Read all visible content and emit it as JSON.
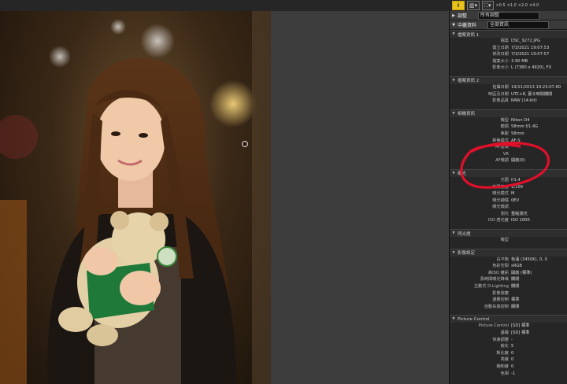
{
  "toolbar": {
    "info_label": "i",
    "zoom_levels": [
      "×0.5",
      "×1.0",
      "×2.0",
      "×4.0"
    ]
  },
  "panel": {
    "adjust": {
      "label": "調整",
      "select": "所有調整"
    },
    "metadata": {
      "label": "中繼資料",
      "select": "全部資訊"
    },
    "sections": [
      {
        "title": "檔案資訊 1",
        "rows": [
          [
            "檔案",
            "DSC_9272.JPG"
          ],
          [
            "建立日期",
            "7/3/2021 19:07:53"
          ],
          [
            "修改日期",
            "7/3/2021 19:07:57"
          ],
          [
            "檔案大小",
            "3.90 MB"
          ],
          [
            "影像大小",
            "L (7380 x 4920), FX"
          ]
        ]
      },
      {
        "title": "檔案資訊 2",
        "rows": [
          [
            "拍攝日期",
            "19/11/2013 19:23:07.60"
          ],
          [
            "時區及日期",
            "UTC+8, 夏令時間關閉"
          ],
          [
            "影像品質",
            "RAW (14-bit)"
          ]
        ]
      },
      {
        "title": "相機資訊",
        "rows": [
          [
            "機型",
            "Nikon D4"
          ],
          [
            "鏡頭",
            "58mm f/1.4G"
          ],
          [
            "焦距",
            "58mm"
          ],
          [
            "對焦模式",
            "AF-S"
          ],
          [
            "AF區域",
            ""
          ],
          [
            "VR",
            ""
          ],
          [
            "AF微調",
            "開啟(0)"
          ]
        ]
      },
      {
        "title": "曝光",
        "rows": [
          [
            "光圈",
            "f/1.4"
          ],
          [
            "快門速度",
            "1/100"
          ],
          [
            "曝光模式",
            "M"
          ],
          [
            "曝光補償",
            "0EV"
          ],
          [
            "曝光微調",
            ""
          ],
          [
            "測光",
            "重點測光"
          ],
          [
            "ISO 感光度",
            "ISO 1000"
          ]
        ]
      },
      {
        "title": "閃光燈",
        "rows": [
          [
            "機型",
            ""
          ]
        ]
      },
      {
        "title": "影像設定",
        "rows": [
          [
            "白平衡",
            "色溫 (3450K), 0, 0"
          ],
          [
            "色彩空間",
            "sRGB"
          ],
          [
            "高ISO 雜訊",
            "開啟 (標準)"
          ],
          [
            "長時間曝光降噪",
            "關閉"
          ],
          [
            "主動式 D-Lighting",
            "關閉"
          ],
          [
            "影像除塵",
            ""
          ],
          [
            "邊暈控制",
            "標準"
          ],
          [
            "自動失真控制",
            "關閉"
          ]
        ]
      },
      {
        "title": "Picture Control",
        "rows": [
          [
            "Picture Control",
            "[SD] 標準"
          ],
          [
            "基礎",
            "[SD] 標準"
          ],
          [
            "快速調整",
            "-"
          ],
          [
            "銳化",
            "5"
          ],
          [
            "對比度",
            "0"
          ],
          [
            "亮度",
            "0"
          ],
          [
            "飽和度",
            "0"
          ],
          [
            "色相",
            "-1"
          ]
        ]
      }
    ]
  },
  "colors": {
    "annotation_red": "#e0102a",
    "info_yellow": "#e7c21b"
  }
}
